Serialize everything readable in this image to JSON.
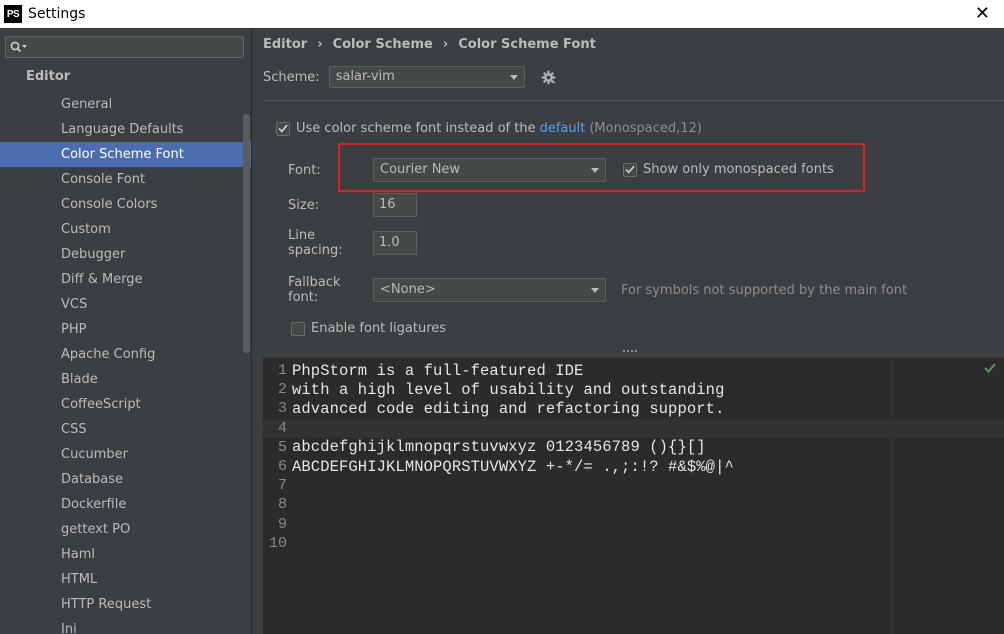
{
  "window": {
    "title": "Settings",
    "app_icon": "PS",
    "close_glyph": "✕"
  },
  "sidebar": {
    "search": {
      "value": "",
      "placeholder": ""
    },
    "section_title": "Editor",
    "items": [
      {
        "label": "General"
      },
      {
        "label": "Language Defaults"
      },
      {
        "label": "Color Scheme Font",
        "selected": true
      },
      {
        "label": "Console Font"
      },
      {
        "label": "Console Colors"
      },
      {
        "label": "Custom"
      },
      {
        "label": "Debugger"
      },
      {
        "label": "Diff & Merge"
      },
      {
        "label": "VCS"
      },
      {
        "label": "PHP"
      },
      {
        "label": "Apache Config"
      },
      {
        "label": "Blade"
      },
      {
        "label": "CoffeeScript"
      },
      {
        "label": "CSS"
      },
      {
        "label": "Cucumber"
      },
      {
        "label": "Database"
      },
      {
        "label": "Dockerfile"
      },
      {
        "label": "gettext PO"
      },
      {
        "label": "Haml"
      },
      {
        "label": "HTML"
      },
      {
        "label": "HTTP Request"
      },
      {
        "label": "Ini"
      }
    ]
  },
  "breadcrumb": [
    "Editor",
    "Color Scheme",
    "Color Scheme Font"
  ],
  "scheme": {
    "label": "Scheme:",
    "value": "salar-vim"
  },
  "use_scheme_font": {
    "checked": true,
    "text": "Use color scheme font instead of the",
    "link": "default",
    "detail": "(Monospaced,12)"
  },
  "font": {
    "label": "Font:",
    "value": "Courier New"
  },
  "monospaced_only": {
    "checked": true,
    "label": "Show only monospaced fonts"
  },
  "size": {
    "label": "Size:",
    "value": "16"
  },
  "line_spacing": {
    "label": "Line spacing:",
    "value": "1.0"
  },
  "fallback_font": {
    "label": "Fallback font:",
    "value": "<None>",
    "hint": "For symbols not supported by the main font"
  },
  "ligatures": {
    "checked": false,
    "label": "Enable font ligatures"
  },
  "preview": {
    "current_line": 4,
    "lines": [
      {
        "n": "1",
        "text": "PhpStorm is a full-featured IDE"
      },
      {
        "n": "2",
        "text": "with a high level of usability and outstanding"
      },
      {
        "n": "3",
        "text": "advanced code editing and refactoring support."
      },
      {
        "n": "4",
        "text": ""
      },
      {
        "n": "5",
        "text": "abcdefghijklmnopqrstuvwxyz 0123456789 (){}[]"
      },
      {
        "n": "6",
        "text": "ABCDEFGHIJKLMNOPQRSTUVWXYZ +-*/= .,;:!? #&$%@|^"
      },
      {
        "n": "7",
        "text": ""
      },
      {
        "n": "8",
        "text": ""
      },
      {
        "n": "9",
        "text": ""
      },
      {
        "n": "10",
        "text": ""
      }
    ]
  },
  "colors": {
    "accent": "#4b6eaf",
    "link": "#589df6",
    "highlight_border": "#e02020",
    "ok_check": "#499c54"
  }
}
